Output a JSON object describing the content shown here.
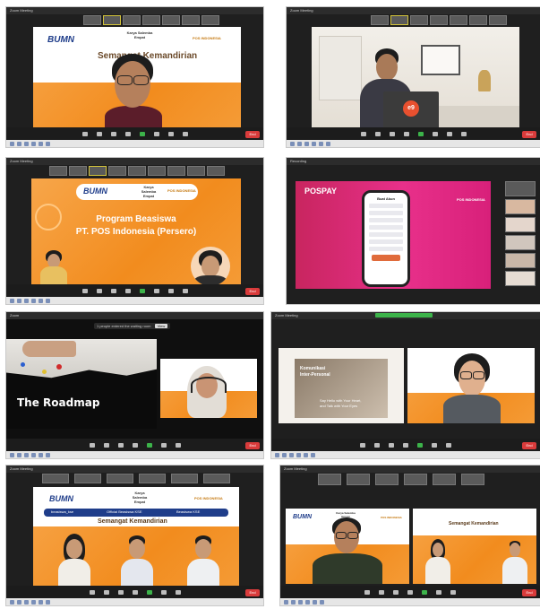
{
  "panels": [
    {
      "id": "p1",
      "window_title": "Zoom Meeting",
      "slide": {
        "logo": "BUMN",
        "logo_sub": "Untuk Indonesia",
        "kse": "Karya Salemba Empat",
        "pos": "POS INDONESIA",
        "heading": "Semangat Kemandirian"
      },
      "end_label": "End"
    },
    {
      "id": "p2",
      "window_title": "Zoom Meeting",
      "laptop_logo": "e9",
      "end_label": "End"
    },
    {
      "id": "p3",
      "window_title": "Zoom Meeting",
      "slide": {
        "logo": "BUMN",
        "kse": "Karya Salemba Empat",
        "pos": "POS INDONESIA",
        "title_line1": "Program Beasiswa",
        "title_line2": "PT. POS Indonesia (Persero)"
      },
      "end_label": "End"
    },
    {
      "id": "p4",
      "window_title": "Recording",
      "slide": {
        "brand": "POSPAY",
        "pos": "POS INDONESIA",
        "phone_header": "Buat Akun",
        "phone_button": ""
      },
      "end_label": "End"
    },
    {
      "id": "p5",
      "window_title": "Zoom",
      "notice": "1 people entered the waiting room",
      "notice_action": "View",
      "slide": {
        "title": "The Roadmap"
      },
      "end_label": "End"
    },
    {
      "id": "p6",
      "window_title": "Zoom Meeting",
      "slide": {
        "title_line1": "Komunikasi",
        "title_line2": "Inter-Personal",
        "caption_line1": "Say Hello with Your Heart,",
        "caption_line2": "and Talk with Your Eyes"
      },
      "end_label": "End"
    },
    {
      "id": "p7",
      "window_title": "Zoom Meeting",
      "slide": {
        "logo": "BUMN",
        "kse": "Karya Salemba Empat",
        "pos": "POS INDONESIA",
        "social_1": "beasiswa_kse",
        "social_2": "Official Beasiswa KSE",
        "social_3": "Beasiswa KSE",
        "heading": "Semangat Kemandirian"
      },
      "end_label": "End"
    },
    {
      "id": "p8",
      "window_title": "Zoom Meeting",
      "slide": {
        "logo": "BUMN",
        "kse": "Karya Salemba Empat",
        "pos": "POS INDONESIA",
        "heading": "Semangat Kemandirian"
      },
      "end_label": "End"
    }
  ],
  "colors": {
    "orange": "#f28c1e",
    "navy": "#1f3d8a",
    "zoom_dark": "#1f1f1f",
    "end_red": "#d93b3b",
    "pink": "#e8308a"
  }
}
